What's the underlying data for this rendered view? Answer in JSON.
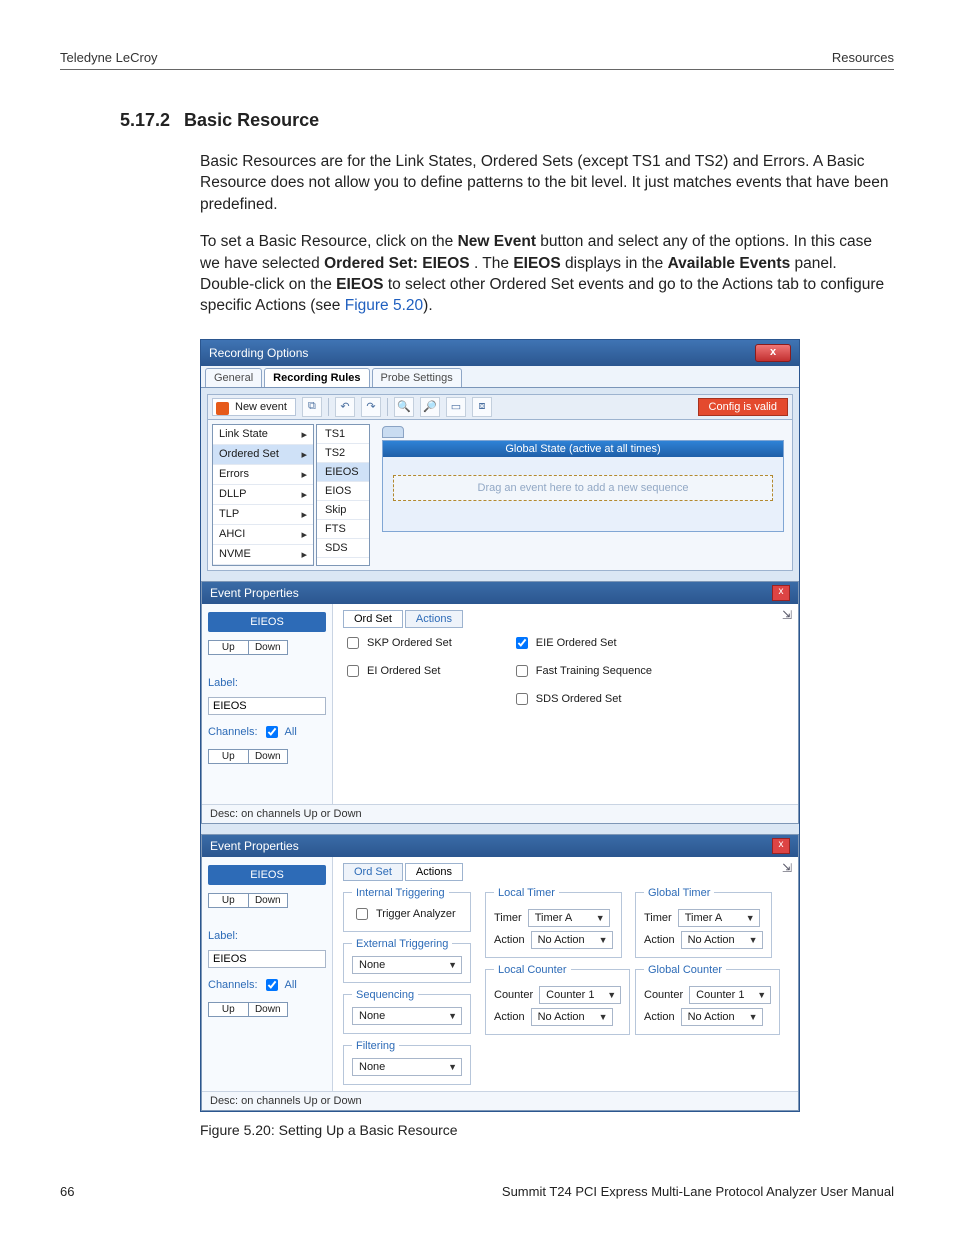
{
  "header": {
    "left": "Teledyne LeCroy",
    "right": "Resources"
  },
  "section": {
    "number": "5.17.2",
    "title": "Basic Resource"
  },
  "para1": "Basic Resources are for the Link States, Ordered Sets (except TS1 and TS2) and Errors. A Basic Resource does not allow you to define patterns to the bit level. It just matches events that have been predefined.",
  "para2_pre": "To set a Basic Resource, click on the ",
  "para2_b1": "New Event",
  "para2_m1": " button and select any of the options. In this case we have selected ",
  "para2_b2": "Ordered Set: EIEOS",
  "para2_m2": ". The ",
  "para2_b3": "EIEOS",
  "para2_m3": " displays in the ",
  "para2_b4": "Available Events",
  "para2_m4": " panel. Double-click on the ",
  "para2_b5": "EIEOS",
  "para2_m5": " to select other Ordered Set events and go to the Actions tab to configure specific Actions (see ",
  "para2_link": "Figure 5.20",
  "para2_end": ").",
  "ro": {
    "title": "Recording Options",
    "close": "x",
    "tabs": {
      "general": "General",
      "rules": "Recording Rules",
      "probe": "Probe Settings"
    },
    "newEvent": "New event",
    "configValid": "Config is valid",
    "menu": {
      "linkState": "Link State",
      "orderedSet": "Ordered Set",
      "errors": "Errors",
      "dllp": "DLLP",
      "tlp": "TLP",
      "ahci": "AHCI",
      "nvme": "NVME"
    },
    "submenu": {
      "ts1": "TS1",
      "ts2": "TS2",
      "eieos": "EIEOS",
      "eios": "EIOS",
      "skip": "Skip",
      "fts": "FTS",
      "sds": "SDS"
    },
    "globalState": "Global State (active at all times)",
    "dropHint": "Drag an event here to add a new sequence"
  },
  "ep1": {
    "title": "Event Properties",
    "badge": "EIEOS",
    "up": "Up",
    "down": "Down",
    "label": "Label:",
    "labelVal": "EIEOS",
    "channels": "Channels:",
    "all": "All",
    "tabs": {
      "ordset": "Ord Set",
      "actions": "Actions"
    },
    "cb": {
      "skp": "SKP Ordered Set",
      "ei": "EI Ordered Set",
      "eie": "EIE Ordered Set",
      "fts": "Fast Training Sequence",
      "sds": "SDS Ordered Set"
    },
    "desc": "Desc:  on channels Up or Down"
  },
  "ep2": {
    "title": "Event Properties",
    "badge": "EIEOS",
    "up": "Up",
    "down": "Down",
    "label": "Label:",
    "labelVal": "EIEOS",
    "channels": "Channels:",
    "all": "All",
    "tabs": {
      "ordset": "Ord Set",
      "actions": "Actions"
    },
    "groups": {
      "internal": {
        "legend": "Internal Triggering",
        "trigger": "Trigger Analyzer"
      },
      "external": {
        "legend": "External Triggering",
        "value": "None"
      },
      "sequencing": {
        "legend": "Sequencing",
        "value": "None"
      },
      "filtering": {
        "legend": "Filtering",
        "value": "None"
      },
      "localTimer": {
        "legend": "Local Timer",
        "timerLbl": "Timer",
        "timer": "Timer A",
        "actionLbl": "Action",
        "action": "No Action"
      },
      "globalTimer": {
        "legend": "Global Timer",
        "timerLbl": "Timer",
        "timer": "Timer A",
        "actionLbl": "Action",
        "action": "No Action"
      },
      "localCounter": {
        "legend": "Local Counter",
        "counterLbl": "Counter",
        "counter": "Counter 1",
        "actionLbl": "Action",
        "action": "No Action"
      },
      "globalCounter": {
        "legend": "Global Counter",
        "counterLbl": "Counter",
        "counter": "Counter 1",
        "actionLbl": "Action",
        "action": "No Action"
      }
    },
    "desc": "Desc:  on channels Up or Down"
  },
  "caption": "Figure 5.20:  Setting Up a Basic Resource",
  "footer": {
    "page": "66",
    "manual": "Summit T24 PCI Express Multi-Lane Protocol Analyzer User Manual"
  }
}
